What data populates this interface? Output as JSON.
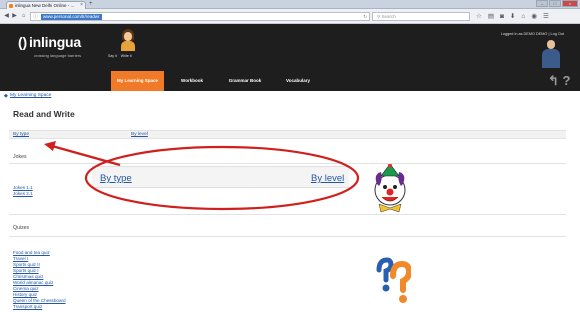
{
  "browser": {
    "tab_title": "inlingua New Delhi Online - ...",
    "tab_close": "×",
    "new_tab": "+",
    "url": "www.personal.com/lr/readwr",
    "search_placeholder": "Search",
    "reload_glyph": "↻",
    "toolbar_icons": [
      "star-icon",
      "bookmarks-icon",
      "pocket-icon",
      "download-icon",
      "home-icon",
      "sync-icon",
      "menu-icon"
    ]
  },
  "site": {
    "logo_text": "inlingua",
    "logo_mark": "()",
    "tagline": "crossing language barriers",
    "avatar_labels": [
      "Say it",
      "Write it"
    ],
    "login_info": "Logged in as DEMO DEMO | Log Out",
    "menu": [
      {
        "label": "My Learning Space",
        "active": true
      },
      {
        "label": "Workbook",
        "active": false
      },
      {
        "label": "Grammar Book",
        "active": false
      },
      {
        "label": "Vocabulary",
        "active": false
      }
    ],
    "accent": "#f07a27",
    "header_bg": "#1e1e1e",
    "help_glyphs": "↰ ?"
  },
  "page": {
    "breadcrumb": "My Learning Space",
    "title": "Read and Write",
    "filter_by_type": "By type",
    "filter_by_level": "By level",
    "sections": [
      {
        "heading": "Jokes",
        "items": [
          "Jokes 1.1",
          "Jokes 2.1"
        ]
      },
      {
        "heading": "Quizes",
        "items": [
          "Food and tea quiz",
          "Travel I",
          "Sports quiz II",
          "Sports quiz I",
          "Christmas quiz",
          "World almanac quiz",
          "Cinema quiz",
          "History quiz",
          "Queen of the Chessboard",
          "Transport quiz"
        ]
      }
    ],
    "link_color": "#2457a8"
  },
  "callout": {
    "by_type": "By type",
    "by_level": "By level",
    "annotation_color": "#d0201e"
  }
}
